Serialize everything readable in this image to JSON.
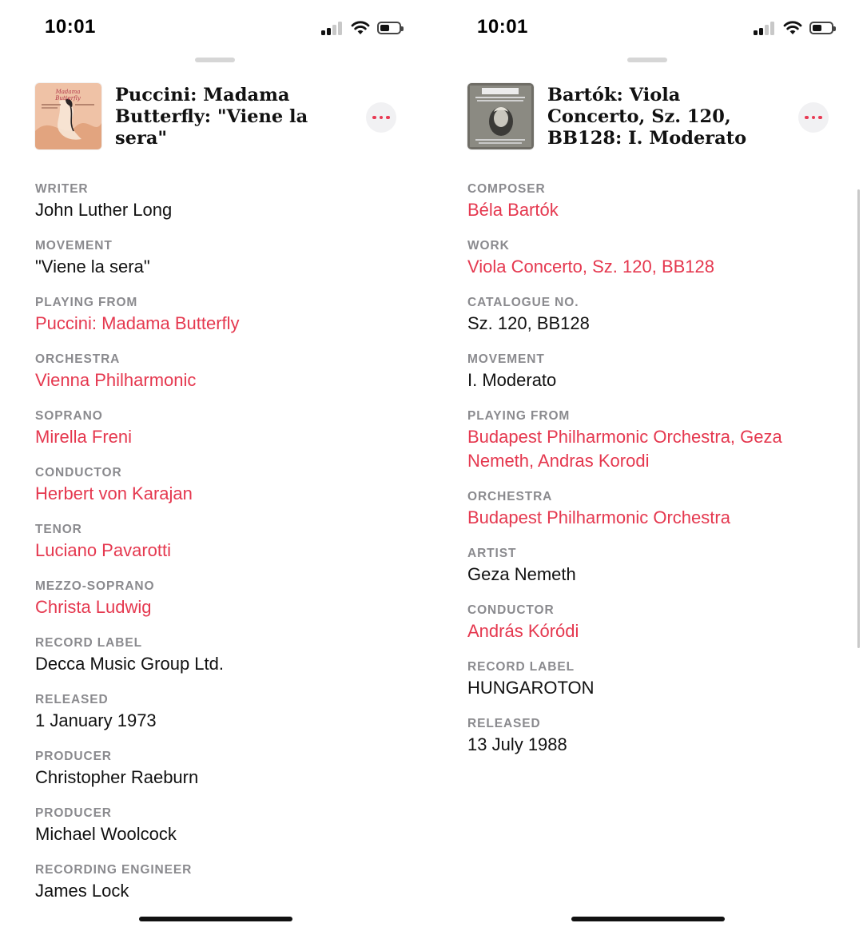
{
  "screens": [
    {
      "status": {
        "time": "10:01"
      },
      "track": {
        "title": "Puccini: Madama Butterfly: \"Viene la sera\"",
        "artwork_icon": "madama-butterfly-album-art"
      },
      "fields": [
        {
          "label": "WRITER",
          "value": "John Luther Long",
          "link": false
        },
        {
          "label": "MOVEMENT",
          "value": "\"Viene la sera\"",
          "link": false
        },
        {
          "label": "PLAYING FROM",
          "value": "Puccini: Madama Butterfly",
          "link": true
        },
        {
          "label": "ORCHESTRA",
          "value": "Vienna Philharmonic",
          "link": true
        },
        {
          "label": "SOPRANO",
          "value": "Mirella Freni",
          "link": true
        },
        {
          "label": "CONDUCTOR",
          "value": "Herbert von Karajan",
          "link": true
        },
        {
          "label": "TENOR",
          "value": "Luciano Pavarotti",
          "link": true
        },
        {
          "label": "MEZZO-SOPRANO",
          "value": "Christa Ludwig",
          "link": true
        },
        {
          "label": "RECORD LABEL",
          "value": "Decca Music Group Ltd.",
          "link": false
        },
        {
          "label": "RELEASED",
          "value": "1 January 1973",
          "link": false
        },
        {
          "label": "PRODUCER",
          "value": "Christopher Raeburn",
          "link": false
        },
        {
          "label": "PRODUCER",
          "value": "Michael Woolcock",
          "link": false
        },
        {
          "label": "RECORDING ENGINEER",
          "value": "James Lock",
          "link": false
        }
      ]
    },
    {
      "status": {
        "time": "10:01"
      },
      "track": {
        "title": "Bartók: Viola Concerto, Sz. 120, BB128: I. Moderato",
        "artwork_icon": "bartok-portrait-album-art"
      },
      "fields": [
        {
          "label": "COMPOSER",
          "value": "Béla Bartók",
          "link": true
        },
        {
          "label": "WORK",
          "value": "Viola Concerto, Sz. 120, BB128",
          "link": true
        },
        {
          "label": "CATALOGUE NO.",
          "value": "Sz. 120, BB128",
          "link": false
        },
        {
          "label": "MOVEMENT",
          "value": "I. Moderato",
          "link": false
        },
        {
          "label": "PLAYING FROM",
          "value": "Budapest Philharmonic Orchestra, Geza Nemeth, Andras Korodi",
          "link": true
        },
        {
          "label": "ORCHESTRA",
          "value": "Budapest Philharmonic Orchestra",
          "link": true
        },
        {
          "label": "ARTIST",
          "value": "Geza Nemeth",
          "link": false
        },
        {
          "label": "CONDUCTOR",
          "value": "András Kóródi",
          "link": true
        },
        {
          "label": "RECORD LABEL",
          "value": "HUNGAROTON",
          "link": false
        },
        {
          "label": "RELEASED",
          "value": "13 July 1988",
          "link": false
        }
      ]
    }
  ],
  "colors": {
    "accent": "#e5384f",
    "label_gray": "#8a8a8e"
  }
}
